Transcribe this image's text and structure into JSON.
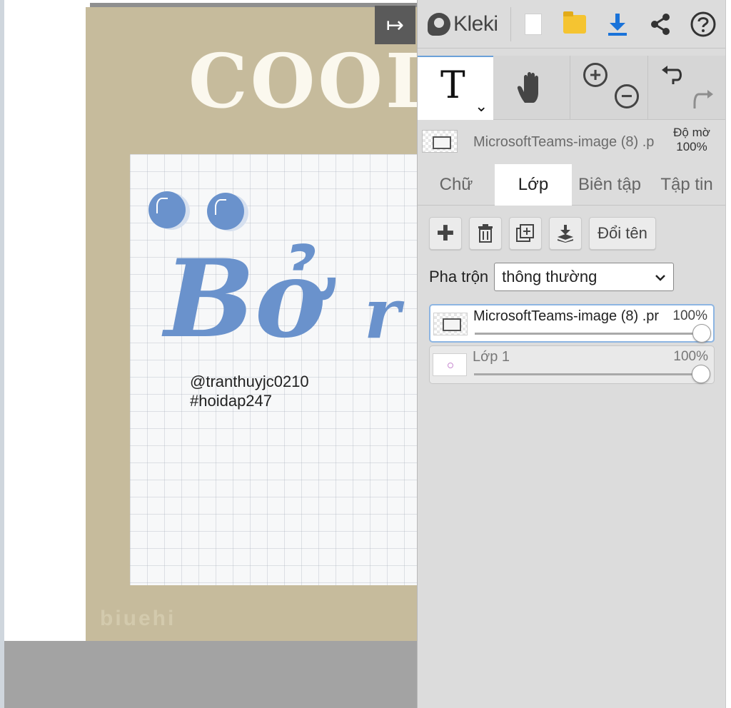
{
  "app": {
    "name": "Kleki"
  },
  "canvas": {
    "artwork_title_text": "COOL",
    "lettering_main": "Bở",
    "lettering_next": "r",
    "handle_line_1": "@tranthuyjc0210",
    "handle_line_2": "#hoidap247",
    "watermark": "biuehi"
  },
  "collapse_button_label": "↦",
  "topbar": {
    "icons": [
      "kleki-logo-icon",
      "new-file-icon",
      "open-file-icon",
      "download-icon",
      "share-icon",
      "help-icon"
    ]
  },
  "toolbar": {
    "text_tool_glyph": "T",
    "text_tool_chevron": "⌄",
    "zoom_in_glyph": "+",
    "zoom_out_glyph": "−"
  },
  "layer_info": {
    "name": "MicrosoftTeams-image (8) .p",
    "opacity_label": "Độ mờ",
    "opacity_value": "100%"
  },
  "tabs": [
    {
      "label": "Chữ",
      "active": false
    },
    {
      "label": "Lớp",
      "active": true
    },
    {
      "label": "Biên tập",
      "active": false
    },
    {
      "label": "Tập tin",
      "active": false
    }
  ],
  "layer_actions": {
    "add_glyph": "✚",
    "rename_label": "Đổi tên"
  },
  "blend": {
    "label": "Pha trộn",
    "selected": "thông thường"
  },
  "layers": [
    {
      "name": "MicrosoftTeams-image (8) .pr",
      "opacity": "100%",
      "opacity_value": 1.0,
      "selected": true
    },
    {
      "name": "Lớp 1",
      "opacity": "100%",
      "opacity_value": 1.0,
      "selected": false
    }
  ],
  "colors": {
    "accent_blue": "#1a73d9",
    "lettering_blue": "#6a92cc",
    "canvas_bg": "#c6bb9c",
    "panel_bg": "#dcdcdc",
    "folder_yellow": "#f5c431"
  }
}
